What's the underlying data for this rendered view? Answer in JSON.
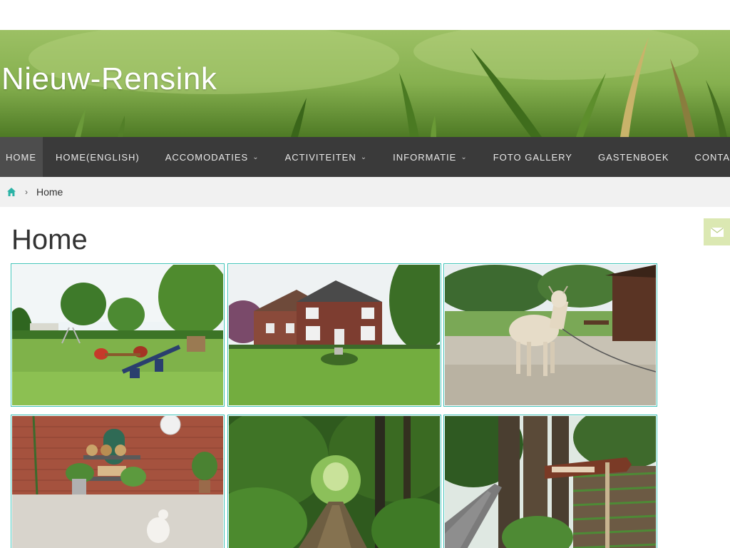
{
  "site": {
    "title": "Nieuw-Rensink"
  },
  "nav": {
    "items": [
      {
        "label": "HOME",
        "active": true,
        "has_dropdown": false
      },
      {
        "label": "HOME(ENGLISH)",
        "active": false,
        "has_dropdown": false
      },
      {
        "label": "ACCOMODATIES",
        "active": false,
        "has_dropdown": true
      },
      {
        "label": "ACTIVITEITEN",
        "active": false,
        "has_dropdown": true
      },
      {
        "label": "INFORMATIE",
        "active": false,
        "has_dropdown": true
      },
      {
        "label": "FOTO GALLERY",
        "active": false,
        "has_dropdown": false
      },
      {
        "label": "GASTENBOEK",
        "active": false,
        "has_dropdown": false
      },
      {
        "label": "CONTACT",
        "active": false,
        "has_dropdown": false
      }
    ],
    "dropdown_icon": "chevron-down-icon"
  },
  "breadcrumb": {
    "home_icon": "home-icon",
    "separator_icon": "chevron-right-icon",
    "current": "Home"
  },
  "page": {
    "title": "Home"
  },
  "mail_tab": {
    "icon": "envelope-icon"
  },
  "gallery": {
    "photos": [
      {
        "subject": "playground-lawn"
      },
      {
        "subject": "farmhouse"
      },
      {
        "subject": "goat"
      },
      {
        "subject": "brick-wall-chicken"
      },
      {
        "subject": "forest-path"
      },
      {
        "subject": "road-sign-trees"
      }
    ]
  },
  "colors": {
    "nav_background": "#3a3a3a",
    "nav_active": "#4d4d4d",
    "accent": "#3fc2b7",
    "breadcrumb_background": "#f1f1f1",
    "mail_tab": "#dbe8b2"
  }
}
